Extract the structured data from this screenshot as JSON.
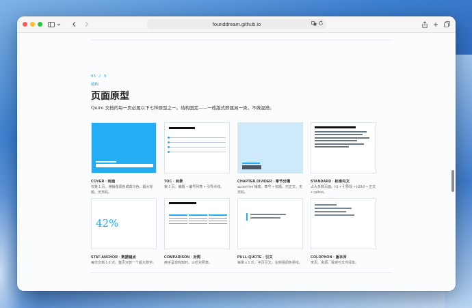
{
  "browser": {
    "url": "founddream.github.io",
    "back_icon": "chevron-left-icon",
    "forward_icon": "chevron-right-icon",
    "sidebar_icon": "sidebar-icon",
    "share_icon": "share-icon",
    "plus_icon": "plus-icon",
    "tabs_icon": "tabs-icon"
  },
  "section": {
    "number": "05 / 9",
    "tag": "结构",
    "title": "页面原型",
    "description": "Quire 文档的每一页必属以下七种原型之一。结构固定——一改版式即属另一类，不做混搭。"
  },
  "cards": [
    {
      "title": "COVER · 封面",
      "desc": "仅第 1 页。满铺强调色或高冷色，超大标题。无页码。"
    },
    {
      "title": "TOC · 目录",
      "desc": "第 2 页。编题 + 编号列表 + 引导点线。"
    },
    {
      "title": "CHAPTER DIVIDER · 章节分隔",
      "desc": "accent-tint 铺底。章号 + 标题。无正文，无页码。"
    },
    {
      "title": "STANDARD · 标准内文",
      "desc": "占大多数页面。h1 + 引导段 + h2/h3 + 正文 + callout。"
    },
    {
      "title": "STAT-ANCHOR · 数据锚点",
      "desc": "每份文档 1-2 次。整页只放一个超大数字。"
    },
    {
      "title": "COMPARISON · 对照",
      "desc": "两手呈现权衡时。三栏对照表。"
    },
    {
      "title": "PULL-QUOTE · 引文",
      "desc": "每章 ≤ 1 次。半页引文，左侧强调色竖线。"
    },
    {
      "title": "COLOPHON · 版本页",
      "desc": "末页。资源、致谢与文件清单。"
    }
  ],
  "stat_sample": "42%",
  "accent_color": "#23adf2"
}
